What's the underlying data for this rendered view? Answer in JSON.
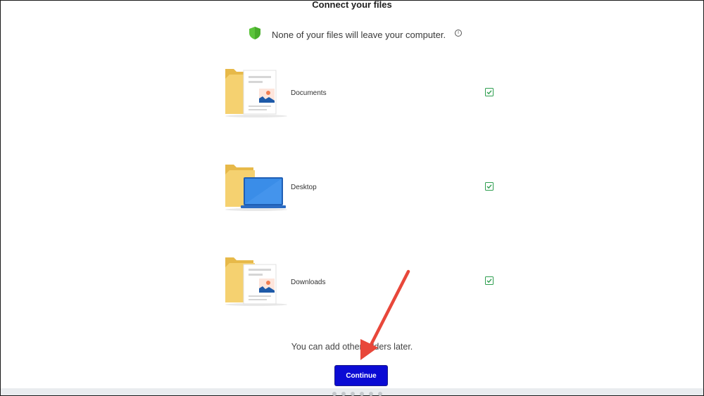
{
  "header": {
    "title": "Connect your files"
  },
  "notice": {
    "text": "None of your files will leave your computer.",
    "icon": "shield-check-icon",
    "info_icon": "info-icon"
  },
  "folders": [
    {
      "label": "Documents",
      "icon": "documents-folder-icon",
      "checked": true
    },
    {
      "label": "Desktop",
      "icon": "desktop-folder-icon",
      "checked": true
    },
    {
      "label": "Downloads",
      "icon": "downloads-folder-icon",
      "checked": true
    }
  ],
  "hint": "You can add other folders later.",
  "continue_label": "Continue",
  "pagination": {
    "total": 6
  },
  "colors": {
    "accent": "#0b0bd4",
    "check": "#2e9e4f",
    "shield": "#5cc43b",
    "arrow": "#e8473a",
    "folder": "#f5d170"
  }
}
